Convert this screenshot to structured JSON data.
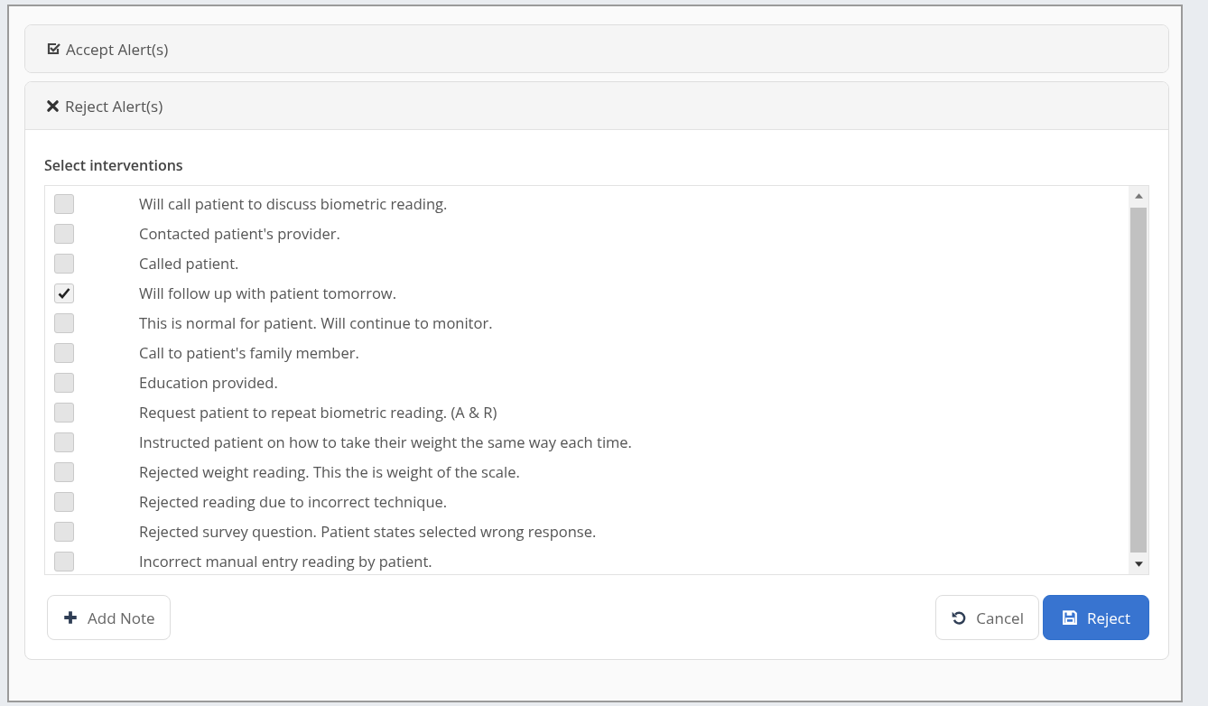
{
  "panels": [
    {
      "kind": "accept",
      "title": "Accept Alert(s)",
      "expanded": false
    },
    {
      "kind": "reject",
      "title": "Reject Alert(s)",
      "expanded": true
    }
  ],
  "interventions": {
    "label": "Select interventions",
    "items": [
      {
        "text": "Will call patient to discuss biometric reading.",
        "checked": false
      },
      {
        "text": "Contacted patient's provider.",
        "checked": false
      },
      {
        "text": "Called patient.",
        "checked": false
      },
      {
        "text": "Will follow up with patient tomorrow.",
        "checked": true
      },
      {
        "text": "This is normal for patient. Will continue to monitor.",
        "checked": false
      },
      {
        "text": "Call to patient's family member.",
        "checked": false
      },
      {
        "text": "Education provided.",
        "checked": false
      },
      {
        "text": "Request patient to repeat biometric reading. (A & R)",
        "checked": false
      },
      {
        "text": "Instructed patient on how to take their weight the same way each time.",
        "checked": false
      },
      {
        "text": "Rejected weight reading. This the is weight of the scale.",
        "checked": false
      },
      {
        "text": "Rejected reading due to incorrect technique.",
        "checked": false
      },
      {
        "text": "Rejected survey question. Patient states selected wrong response.",
        "checked": false
      },
      {
        "text": "Incorrect manual entry reading by patient.",
        "checked": false
      }
    ]
  },
  "buttons": [
    {
      "kind": "add",
      "label": "Add Note"
    },
    {
      "kind": "cancel",
      "label": "Cancel"
    },
    {
      "kind": "reject",
      "label": "Reject"
    }
  ]
}
